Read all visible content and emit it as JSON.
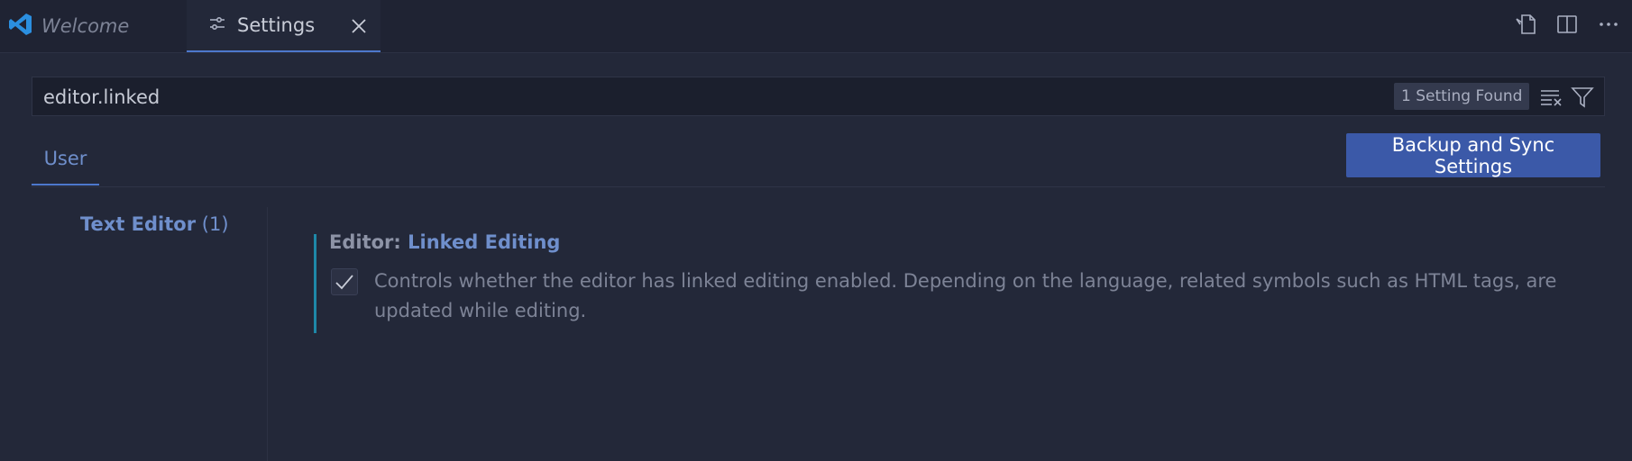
{
  "tabs": {
    "welcome": {
      "label": "Welcome",
      "icon": "vscode-logo-icon"
    },
    "settings": {
      "label": "Settings",
      "icon": "settings-sliders-icon",
      "close_icon": "close-icon"
    }
  },
  "top_actions": [
    "open-settings-json-icon",
    "split-editor-icon",
    "more-actions-icon"
  ],
  "search": {
    "value": "editor.linked",
    "result_count": "1 Setting Found",
    "clear_icon": "clear-filter-icon",
    "filter_icon": "filter-icon"
  },
  "scope": {
    "user_label": "User"
  },
  "sync_button": {
    "label": "Backup and Sync Settings"
  },
  "toc": {
    "item_title": "Text Editor",
    "item_count": "(1)"
  },
  "setting": {
    "category": "Editor: ",
    "name": "Linked Editing",
    "checked": true,
    "description": "Controls whether the editor has linked editing enabled. Depending on the language, related symbols such as HTML tags, are updated while editing."
  },
  "colors": {
    "background": "#232839",
    "accent": "#4d78cc",
    "button": "#3b59a8",
    "modified_bar": "#1e88a8"
  }
}
